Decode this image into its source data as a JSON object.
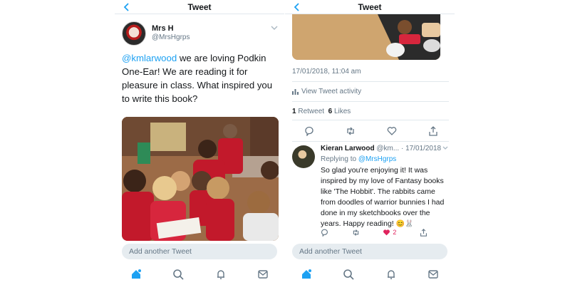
{
  "colors": {
    "accent": "#1da1f2",
    "like": "#e0245e",
    "muted": "#657786",
    "text": "#14171a",
    "border": "#e1e8ed"
  },
  "left": {
    "nav_title": "Tweet",
    "author": {
      "name": "Mrs H",
      "handle": "@MrsHgrps"
    },
    "tweet": {
      "mention": "@kmlarwood",
      "text": " we are loving Podkin One-Ear! We are reading it for pleasure in class. What inspired you to write this book?"
    },
    "compose_placeholder": "Add another Tweet"
  },
  "right": {
    "nav_title": "Tweet",
    "timestamp": "17/01/2018, 11:04 am",
    "activity_label": "View Tweet activity",
    "stats": {
      "retweets": "1",
      "retweets_label": "Retweet",
      "likes": "6",
      "likes_label": "Likes"
    },
    "reply": {
      "name": "Kieran Larwood",
      "handle_date": "@km... · 17/01/2018",
      "replying_prefix": "Replying to ",
      "replying_to": "@MrsHgrps",
      "text": "So glad you're enjoying it! It was inspired by my love of Fantasy books like 'The Hobbit'. The rabbits came from doodles of warrior bunnies I had done in my sketchbooks over the years. Happy reading! ",
      "emoji": "😊🐰",
      "like_count": "2"
    },
    "compose_placeholder": "Add another Tweet"
  },
  "tabs": [
    "home-icon",
    "search-icon",
    "notifications-icon",
    "messages-icon"
  ]
}
